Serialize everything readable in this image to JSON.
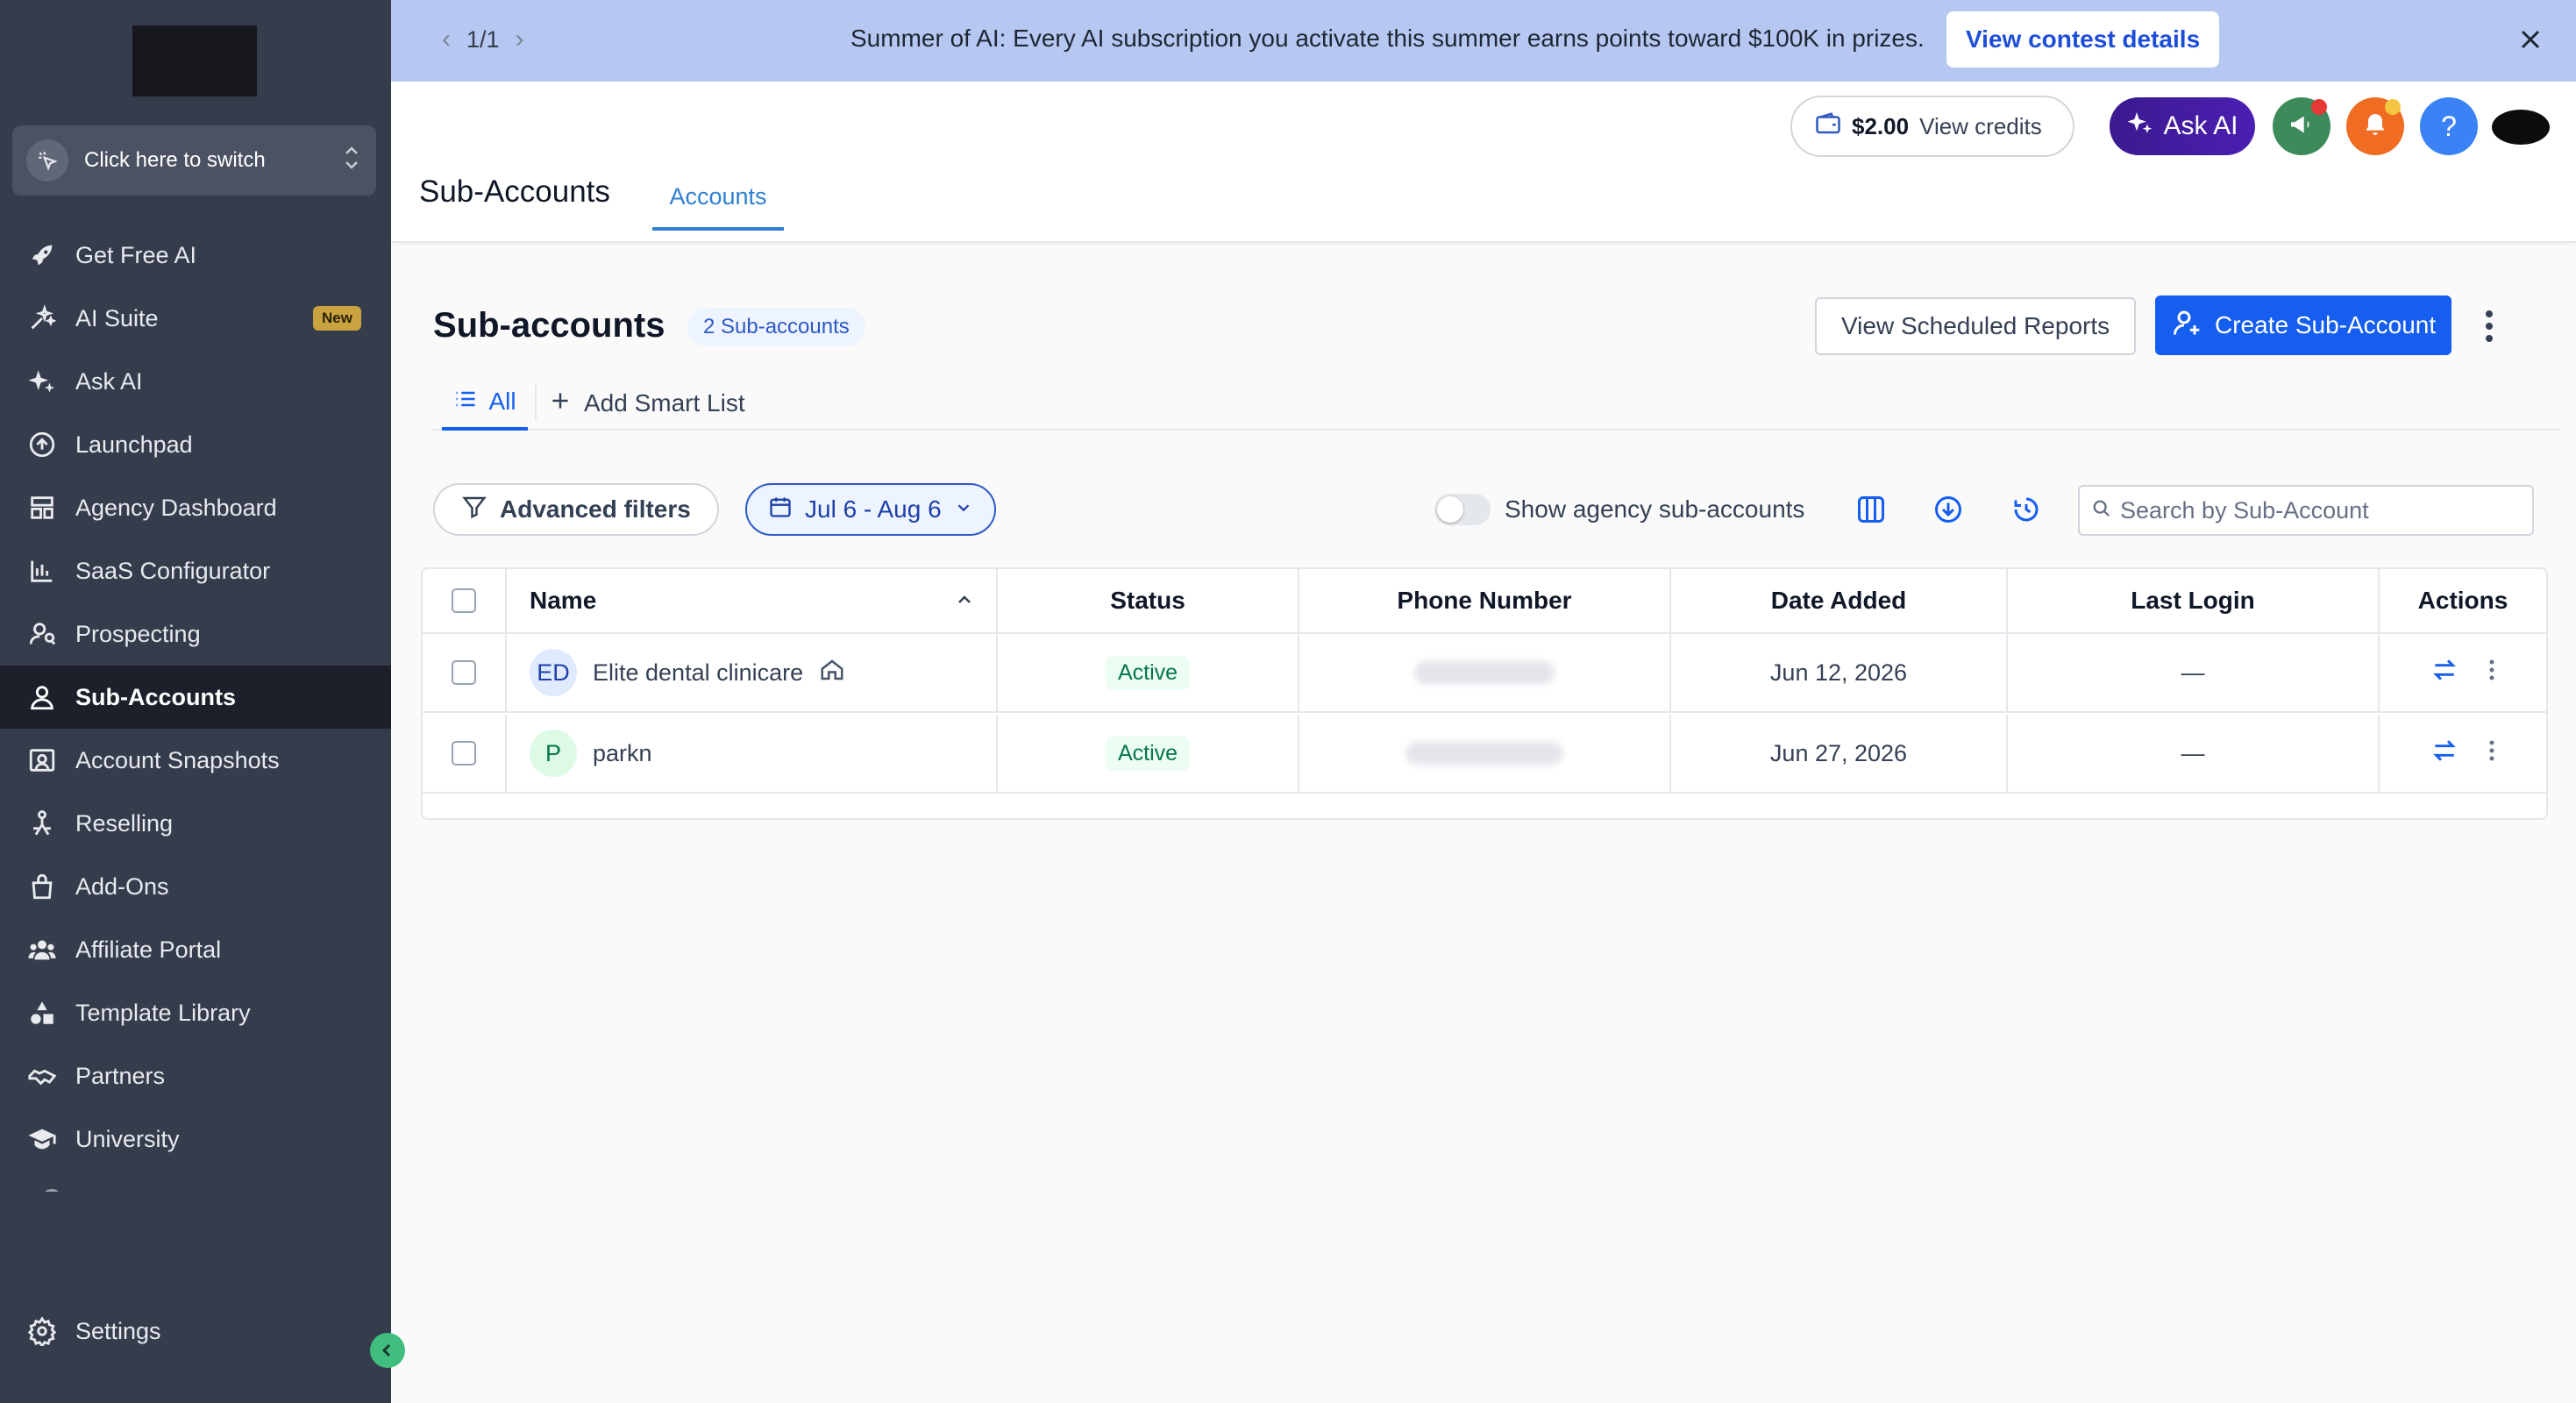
{
  "sidebar": {
    "switcher_label": "Click here to switch",
    "items": [
      {
        "label": "Get Free AI",
        "icon": "rocket-icon"
      },
      {
        "label": "AI Suite",
        "icon": "sparkle-icon",
        "badge": "New"
      },
      {
        "label": "Ask AI",
        "icon": "sparkles-icon"
      },
      {
        "label": "Launchpad",
        "icon": "launchpad-icon"
      },
      {
        "label": "Agency Dashboard",
        "icon": "dashboard-icon"
      },
      {
        "label": "SaaS Configurator",
        "icon": "chart-icon"
      },
      {
        "label": "Prospecting",
        "icon": "prospecting-icon"
      },
      {
        "label": "Sub-Accounts",
        "icon": "user-icon",
        "active": true
      },
      {
        "label": "Account Snapshots",
        "icon": "snapshot-icon"
      },
      {
        "label": "Reselling",
        "icon": "reselling-icon"
      },
      {
        "label": "Add-Ons",
        "icon": "bag-icon"
      },
      {
        "label": "Affiliate Portal",
        "icon": "users-icon"
      },
      {
        "label": "Template Library",
        "icon": "shapes-icon"
      },
      {
        "label": "Partners",
        "icon": "handshake-icon"
      },
      {
        "label": "University",
        "icon": "graduation-cap-icon"
      }
    ],
    "settings_label": "Settings"
  },
  "banner": {
    "pager": "1/1",
    "message": "Summer of AI: Every AI subscription you activate this summer earns points toward $100K in prizes.",
    "cta": "View contest details"
  },
  "header": {
    "credits_amount": "$2.00",
    "credits_label": "View credits",
    "ask_ai": "Ask AI",
    "title": "Sub-Accounts",
    "tab": "Accounts"
  },
  "main": {
    "title": "Sub-accounts",
    "count": "2 Sub-accounts",
    "view_reports": "View Scheduled Reports",
    "create": "Create Sub-Account",
    "tab_all": "All",
    "tab_add": "Add Smart List",
    "advanced_filters": "Advanced filters",
    "date_range": "Jul 6 - Aug 6",
    "toggle_label": "Show agency sub-accounts",
    "search_placeholder": "Search by Sub-Account"
  },
  "table": {
    "columns": [
      "Name",
      "Status",
      "Phone Number",
      "Date Added",
      "Last Login",
      "Actions"
    ],
    "rows": [
      {
        "initials": "ED",
        "name": "Elite dental clinicare",
        "status": "Active",
        "date": "Jun 12, 2026",
        "last_login": "—"
      },
      {
        "initials": "P",
        "name": "parkn",
        "status": "Active",
        "date": "Jun 27, 2026",
        "last_login": "—"
      }
    ]
  },
  "colors": {
    "sidebar_bg": "#353d4c",
    "banner_bg": "#b6c8f2",
    "primary": "#155eef",
    "active_tab": "#2f80d1",
    "status_active": "#067647"
  }
}
